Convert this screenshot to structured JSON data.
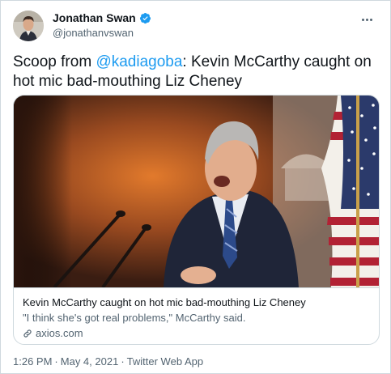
{
  "author": {
    "name": "Jonathan Swan",
    "handle": "@jonathanvswan",
    "verified_icon": "verified-badge-icon",
    "accent": "#1d9bf0"
  },
  "tweet": {
    "text_prefix": "Scoop from ",
    "mention": "@kadiagoba",
    "text_suffix": ": Kevin McCarthy caught on hot mic bad-mouthing Liz Cheney"
  },
  "card": {
    "title": "Kevin McCarthy caught on hot mic bad-mouthing Liz Cheney",
    "description": "\"I think she's got real problems,\" McCarthy said.",
    "domain": "axios.com",
    "link_icon": "link-icon"
  },
  "footer": {
    "time": "1:26 PM",
    "date": "May 4, 2021",
    "source": "Twitter Web App",
    "separator": "·"
  }
}
